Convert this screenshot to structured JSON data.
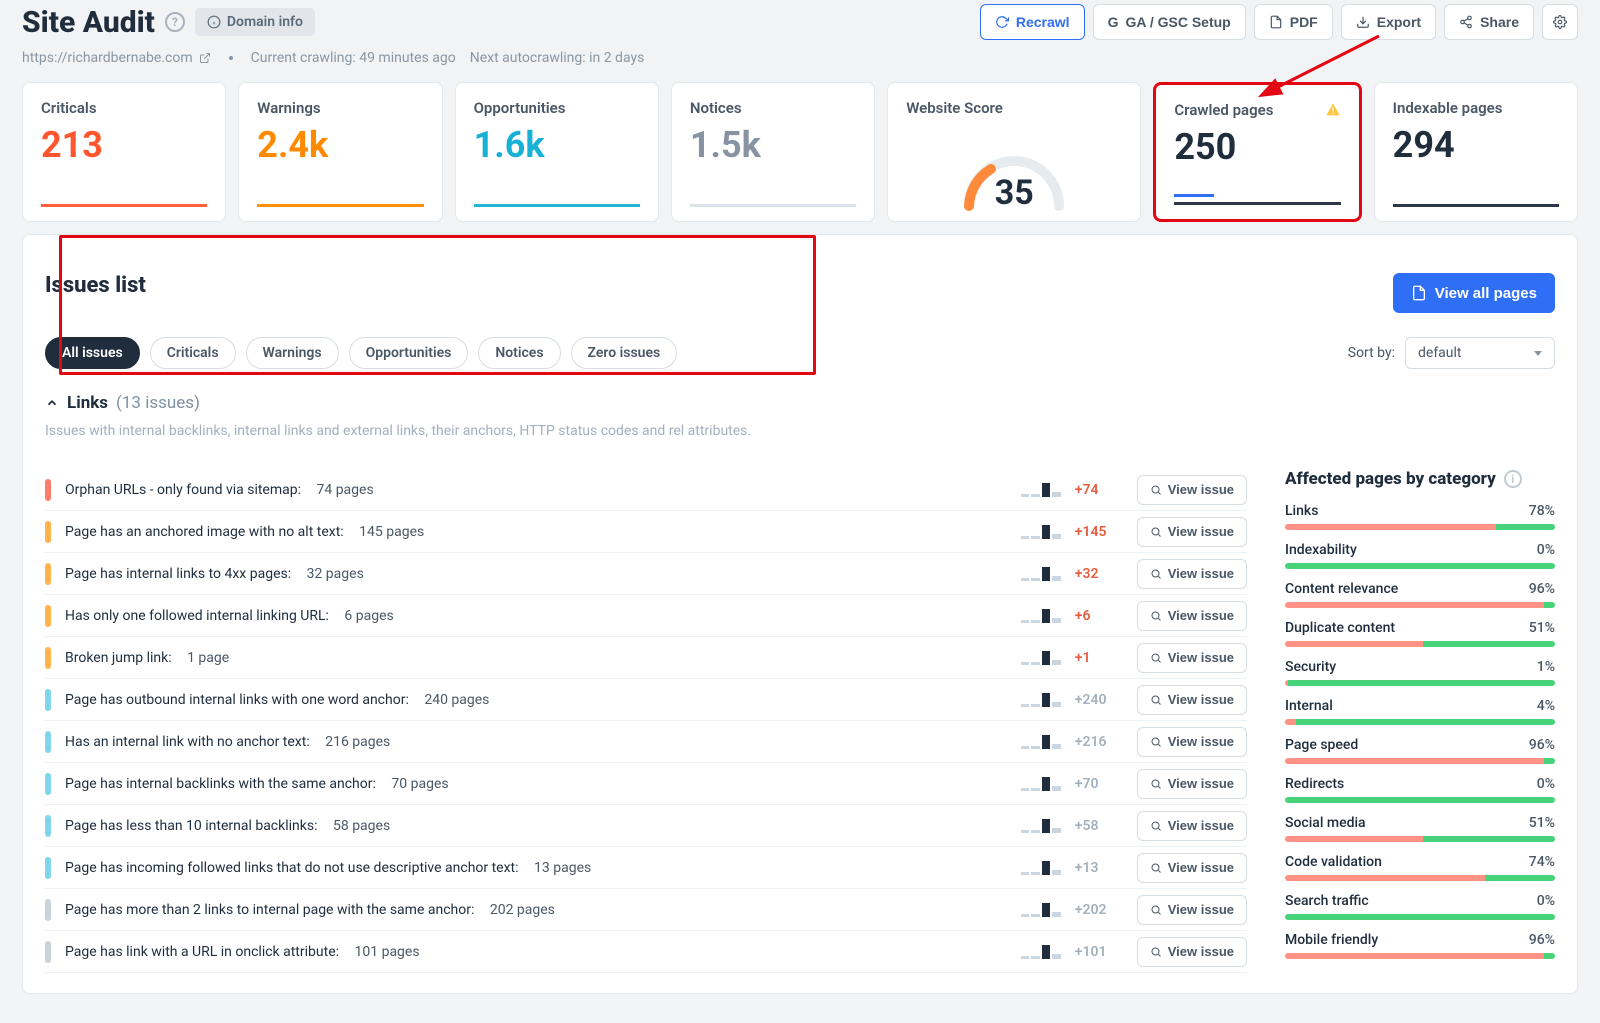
{
  "header": {
    "title": "Site Audit",
    "domain_chip": "Domain info",
    "actions": {
      "recrawl": "Recrawl",
      "ga": "GA / GSC Setup",
      "pdf": "PDF",
      "export": "Export",
      "share": "Share"
    }
  },
  "subheader": {
    "url": "https://richardbernabe.com",
    "crawl_status": "Current crawling: 49 minutes ago",
    "autocrawl": "Next autocrawling: in 2 days"
  },
  "cards": {
    "criticals": {
      "label": "Criticals",
      "value": "213"
    },
    "warnings": {
      "label": "Warnings",
      "value": "2.4k"
    },
    "opportunities": {
      "label": "Opportunities",
      "value": "1.6k"
    },
    "notices": {
      "label": "Notices",
      "value": "1.5k"
    },
    "score": {
      "label": "Website Score",
      "value": "35"
    },
    "crawled": {
      "label": "Crawled pages",
      "value": "250"
    },
    "indexable": {
      "label": "Indexable pages",
      "value": "294"
    }
  },
  "issues_panel": {
    "title": "Issues list",
    "view_all": "View all pages",
    "filters": [
      "All issues",
      "Criticals",
      "Warnings",
      "Opportunities",
      "Notices",
      "Zero issues"
    ],
    "sort_label": "Sort by:",
    "sort_value": "default"
  },
  "links_section": {
    "title": "Links",
    "count": "(13 issues)",
    "desc": "Issues with internal backlinks, internal links and external links, their anchors, HTTP status codes and rel attributes."
  },
  "view_issue_label": "View issue",
  "issues": [
    {
      "pill": "p-red",
      "name": "Orphan URLs - only found via sitemap:",
      "pages": "74 pages",
      "delta": "+74",
      "dc": "d-red"
    },
    {
      "pill": "p-orange",
      "name": "Page has an anchored image with no alt text:",
      "pages": "145 pages",
      "delta": "+145",
      "dc": "d-red"
    },
    {
      "pill": "p-orange",
      "name": "Page has internal links to 4xx pages:",
      "pages": "32 pages",
      "delta": "+32",
      "dc": "d-red"
    },
    {
      "pill": "p-orange",
      "name": "Has only one followed internal linking URL:",
      "pages": "6 pages",
      "delta": "+6",
      "dc": "d-red"
    },
    {
      "pill": "p-orange",
      "name": "Broken jump link:",
      "pages": "1 page",
      "delta": "+1",
      "dc": "d-red"
    },
    {
      "pill": "p-cyan",
      "name": "Page has outbound internal links with one word anchor:",
      "pages": "240 pages",
      "delta": "+240",
      "dc": "d-grey"
    },
    {
      "pill": "p-cyan",
      "name": "Has an internal link with no anchor text:",
      "pages": "216 pages",
      "delta": "+216",
      "dc": "d-grey"
    },
    {
      "pill": "p-cyan",
      "name": "Page has internal backlinks with the same anchor:",
      "pages": "70 pages",
      "delta": "+70",
      "dc": "d-grey"
    },
    {
      "pill": "p-cyan",
      "name": "Page has less than 10 internal backlinks:",
      "pages": "58 pages",
      "delta": "+58",
      "dc": "d-grey"
    },
    {
      "pill": "p-cyan",
      "name": "Page has incoming followed links that do not use descriptive anchor text:",
      "pages": "13 pages",
      "delta": "+13",
      "dc": "d-grey"
    },
    {
      "pill": "p-grey",
      "name": "Page has more than 2 links to internal page with the same anchor:",
      "pages": "202 pages",
      "delta": "+202",
      "dc": "d-grey"
    },
    {
      "pill": "p-grey",
      "name": "Page has link with a URL in onclick attribute:",
      "pages": "101 pages",
      "delta": "+101",
      "dc": "d-grey"
    }
  ],
  "side": {
    "title": "Affected pages by category",
    "categories": [
      {
        "name": "Links",
        "pct": "78%",
        "red": 78,
        "green": 22
      },
      {
        "name": "Indexability",
        "pct": "0%",
        "red": 0,
        "green": 100
      },
      {
        "name": "Content relevance",
        "pct": "96%",
        "red": 96,
        "green": 4
      },
      {
        "name": "Duplicate content",
        "pct": "51%",
        "red": 51,
        "green": 49
      },
      {
        "name": "Security",
        "pct": "1%",
        "red": 1,
        "green": 99
      },
      {
        "name": "Internal",
        "pct": "4%",
        "red": 4,
        "green": 96
      },
      {
        "name": "Page speed",
        "pct": "96%",
        "red": 96,
        "green": 4
      },
      {
        "name": "Redirects",
        "pct": "0%",
        "red": 0,
        "green": 100
      },
      {
        "name": "Social media",
        "pct": "51%",
        "red": 51,
        "green": 49
      },
      {
        "name": "Code validation",
        "pct": "74%",
        "red": 74,
        "green": 26
      },
      {
        "name": "Search traffic",
        "pct": "0%",
        "red": 0,
        "green": 100
      },
      {
        "name": "Mobile friendly",
        "pct": "96%",
        "red": 96,
        "green": 4
      }
    ]
  }
}
